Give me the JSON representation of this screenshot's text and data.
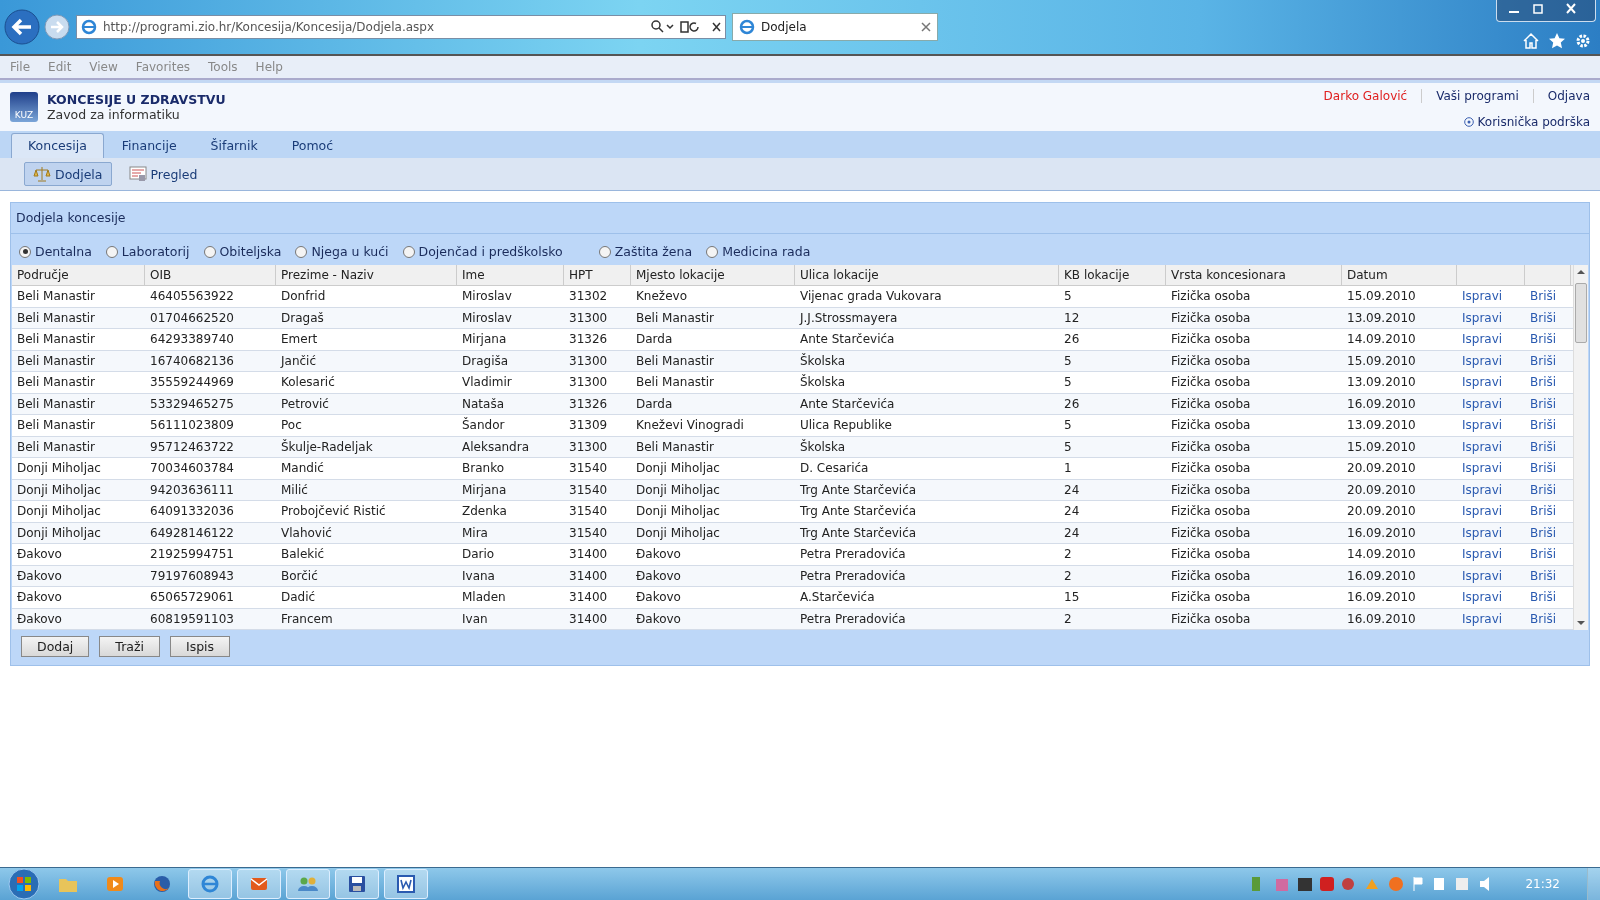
{
  "browser": {
    "address": "http://programi.zio.hr/Koncesija/Koncesija/Dodjela.aspx",
    "tab_title": "Dodjela"
  },
  "menu": [
    "File",
    "Edit",
    "View",
    "Favorites",
    "Tools",
    "Help"
  ],
  "header": {
    "title": "KONCESIJE U ZDRAVSTVU",
    "subtitle": "Zavod za informatiku",
    "logo": "KUZ",
    "user": "Darko Galović",
    "links": [
      "Vaši programi",
      "Odjava"
    ],
    "support": "Korisnička podrška"
  },
  "tabs": [
    {
      "label": "Koncesija",
      "selected": true
    },
    {
      "label": "Financije",
      "selected": false
    },
    {
      "label": "Šifarnik",
      "selected": false
    },
    {
      "label": "Pomoć",
      "selected": false
    }
  ],
  "subtabs": [
    {
      "label": "Dodjela",
      "selected": true
    },
    {
      "label": "Pregled",
      "selected": false
    }
  ],
  "panel": {
    "title": "Dodjela koncesije",
    "radios": [
      {
        "label": "Dentalna",
        "selected": true
      },
      {
        "label": "Laboratorij",
        "selected": false
      },
      {
        "label": "Obiteljska",
        "selected": false
      },
      {
        "label": "Njega u kući",
        "selected": false
      },
      {
        "label": "Dojenčad i predškolsko",
        "selected": false
      },
      {
        "label": "Zaštita žena",
        "selected": false
      },
      {
        "label": "Medicina rada",
        "selected": false
      }
    ],
    "table": {
      "columns": [
        "Područje",
        "OIB",
        "Prezime - Naziv",
        "Ime",
        "HPT",
        "Mjesto lokacije",
        "Ulica lokacije",
        "KB lokacije",
        "Vrsta koncesionara",
        "Datum"
      ],
      "rows": [
        {
          "cells": [
            "Beli Manastir",
            "46405563922",
            "Donfrid",
            "Miroslav",
            "31302",
            "Kneževo",
            "Vijenac grada Vukovara",
            "5",
            "Fizička osoba",
            "15.09.2010"
          ],
          "edit": "Ispravi",
          "delete": "Briši"
        },
        {
          "cells": [
            "Beli Manastir",
            "01704662520",
            "Dragaš",
            "Miroslav",
            "31300",
            "Beli Manastir",
            "J.J.Strossmayera",
            "12",
            "Fizička osoba",
            "13.09.2010"
          ],
          "edit": "Ispravi",
          "delete": "Briši"
        },
        {
          "cells": [
            "Beli Manastir",
            "64293389740",
            "Emert",
            "Mirjana",
            "31326",
            "Darda",
            "Ante Starčevića",
            "26",
            "Fizička osoba",
            "14.09.2010"
          ],
          "edit": "Ispravi",
          "delete": "Briši"
        },
        {
          "cells": [
            "Beli Manastir",
            "16740682136",
            "Jančić",
            "Dragiša",
            "31300",
            "Beli Manastir",
            "Školska",
            "5",
            "Fizička osoba",
            "15.09.2010"
          ],
          "edit": "Ispravi",
          "delete": "Briši"
        },
        {
          "cells": [
            "Beli Manastir",
            "35559244969",
            "Kolesarić",
            "Vladimir",
            "31300",
            "Beli Manastir",
            "Školska",
            "5",
            "Fizička osoba",
            "13.09.2010"
          ],
          "edit": "Ispravi",
          "delete": "Briši"
        },
        {
          "cells": [
            "Beli Manastir",
            "53329465275",
            "Petrović",
            "Nataša",
            "31326",
            "Darda",
            "Ante Starčevića",
            "26",
            "Fizička osoba",
            "16.09.2010"
          ],
          "edit": "Ispravi",
          "delete": "Briši"
        },
        {
          "cells": [
            "Beli Manastir",
            "56111023809",
            "Poc",
            "Šandor",
            "31309",
            "Kneževi Vinogradi",
            "Ulica Republike",
            "5",
            "Fizička osoba",
            "13.09.2010"
          ],
          "edit": "Ispravi",
          "delete": "Briši"
        },
        {
          "cells": [
            "Beli Manastir",
            "95712463722",
            "Škulje-Radeljak",
            "Aleksandra",
            "31300",
            "Beli Manastir",
            "Školska",
            "5",
            "Fizička osoba",
            "15.09.2010"
          ],
          "edit": "Ispravi",
          "delete": "Briši"
        },
        {
          "cells": [
            "Donji Miholjac",
            "70034603784",
            "Mandić",
            "Branko",
            "31540",
            "Donji Miholjac",
            "D. Cesarića",
            "1",
            "Fizička osoba",
            "20.09.2010"
          ],
          "edit": "Ispravi",
          "delete": "Briši"
        },
        {
          "cells": [
            "Donji Miholjac",
            "94203636111",
            "Milić",
            "Mirjana",
            "31540",
            "Donji Miholjac",
            "Trg Ante Starčevića",
            "24",
            "Fizička osoba",
            "20.09.2010"
          ],
          "edit": "Ispravi",
          "delete": "Briši"
        },
        {
          "cells": [
            "Donji Miholjac",
            "64091332036",
            "Probojčević Ristić",
            "Zdenka",
            "31540",
            "Donji Miholjac",
            "Trg Ante Starčevića",
            "24",
            "Fizička osoba",
            "20.09.2010"
          ],
          "edit": "Ispravi",
          "delete": "Briši"
        },
        {
          "cells": [
            "Donji Miholjac",
            "64928146122",
            "Vlahović",
            "Mira",
            "31540",
            "Donji Miholjac",
            "Trg Ante Starčevića",
            "24",
            "Fizička osoba",
            "16.09.2010"
          ],
          "edit": "Ispravi",
          "delete": "Briši"
        },
        {
          "cells": [
            "Đakovo",
            "21925994751",
            "Balekić",
            "Dario",
            "31400",
            "Đakovo",
            "Petra Preradovića",
            "2",
            "Fizička osoba",
            "14.09.2010"
          ],
          "edit": "Ispravi",
          "delete": "Briši"
        },
        {
          "cells": [
            "Đakovo",
            "79197608943",
            "Borčić",
            "Ivana",
            "31400",
            "Đakovo",
            "Petra Preradovića",
            "2",
            "Fizička osoba",
            "16.09.2010"
          ],
          "edit": "Ispravi",
          "delete": "Briši"
        },
        {
          "cells": [
            "Đakovo",
            "65065729061",
            "Dadić",
            "Mladen",
            "31400",
            "Đakovo",
            "A.Starčevića",
            "15",
            "Fizička osoba",
            "16.09.2010"
          ],
          "edit": "Ispravi",
          "delete": "Briši"
        },
        {
          "cells": [
            "Đakovo",
            "60819591103",
            "Francem",
            "Ivan",
            "31400",
            "Đakovo",
            "Petra Preradovića",
            "2",
            "Fizička osoba",
            "16.09.2010"
          ],
          "edit": "Ispravi",
          "delete": "Briši"
        }
      ]
    },
    "buttons": [
      "Dodaj",
      "Traži",
      "Ispis"
    ]
  },
  "taskbar": {
    "clock": "21:32"
  }
}
